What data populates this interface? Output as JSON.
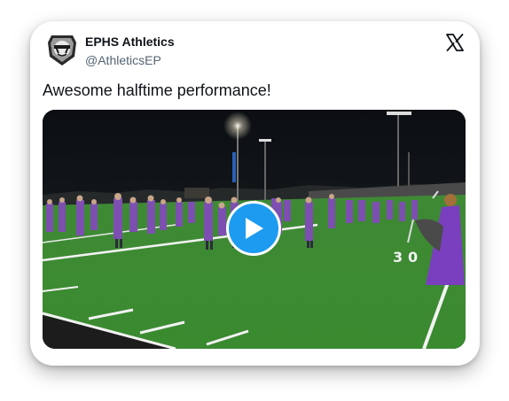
{
  "tweet": {
    "author": {
      "display_name": "EPHS Athletics",
      "handle": "@AthleticsEP",
      "avatar_icon": "raider-shield-icon"
    },
    "text": "Awesome halftime performance!",
    "platform_icon": "x-logo-icon",
    "media": {
      "type": "video",
      "play_icon": "play-icon",
      "play_color": "#1d9bf0"
    }
  }
}
